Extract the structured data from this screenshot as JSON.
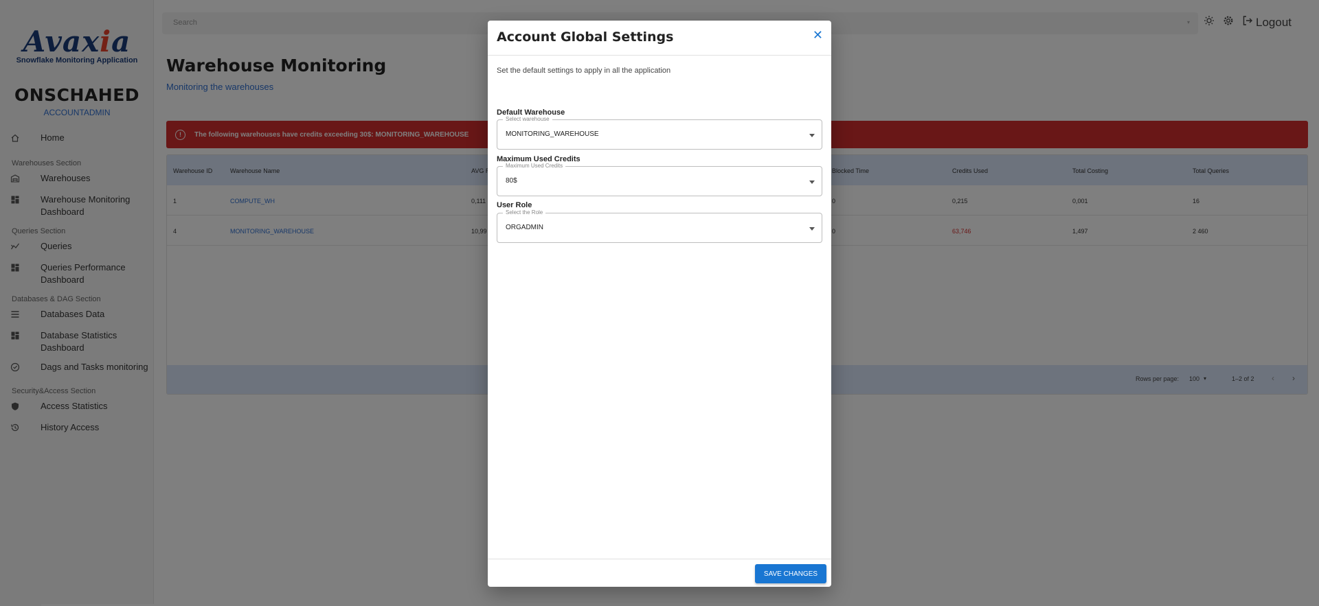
{
  "brand": {
    "logo_text_a": "Avax",
    "logo_text_x": "i",
    "logo_text_b": "a",
    "subtitle": "Snowflake Monitoring Application"
  },
  "account": {
    "name": "ONSCHAHED",
    "role": "ACCOUNTADMIN"
  },
  "sidebar": {
    "home": "Home",
    "sections": [
      {
        "title": "Warehouses Section",
        "items": [
          "Warehouses",
          "Warehouse Monitoring Dashboard"
        ]
      },
      {
        "title": "Queries Section",
        "items": [
          "Queries",
          "Queries Performance Dashboard"
        ]
      },
      {
        "title": "Databases & DAG Section",
        "items": [
          "Databases Data",
          "Database Statistics Dashboard",
          "Dags and Tasks monitoring"
        ]
      },
      {
        "title": "Security&Access Section",
        "items": [
          "Access Statistics",
          "History Access"
        ]
      }
    ]
  },
  "topbar": {
    "search_placeholder": "Search",
    "logout_label": "Logout"
  },
  "page": {
    "title": "Warehouse Monitoring",
    "subtitle": "Monitoring the warehouses"
  },
  "alert": {
    "text": "The following warehouses have credits exceeding 30$: MONITORING_WAREHOUSE",
    "color": "#d32f2f"
  },
  "table": {
    "columns": [
      "Warehouse ID",
      "Warehouse Name",
      "AVG R",
      "Blocked Time",
      "Credits Used",
      "Total Costing",
      "Total Queries"
    ],
    "rows": [
      {
        "id": "1",
        "name": "COMPUTE_WH",
        "avg": "0,111",
        "blocked": "0",
        "credits": "0,215",
        "costing": "0,001",
        "queries": "16"
      },
      {
        "id": "4",
        "name": "MONITORING_WAREHOUSE",
        "avg": "10,99",
        "blocked": "0",
        "credits": "63,746",
        "costing": "1,497",
        "queries": "2 460"
      }
    ],
    "footer": {
      "rows_per_page_label": "Rows per page:",
      "rows_per_page": "100",
      "range": "1–2 of 2"
    }
  },
  "modal": {
    "title": "Account Global Settings",
    "description": "Set the default settings to apply in all the application",
    "fields": [
      {
        "label": "Default Warehouse",
        "legend": "Select warehouse",
        "value": "MONITORING_WAREHOUSE"
      },
      {
        "label": "Maximum Used Credits",
        "legend": "Maximum Used Credits",
        "value": "80$"
      },
      {
        "label": "User Role",
        "legend": "Select the Role",
        "value": "ORGADMIN"
      }
    ],
    "save_label": "SAVE CHANGES",
    "accent": "#1976d2"
  }
}
